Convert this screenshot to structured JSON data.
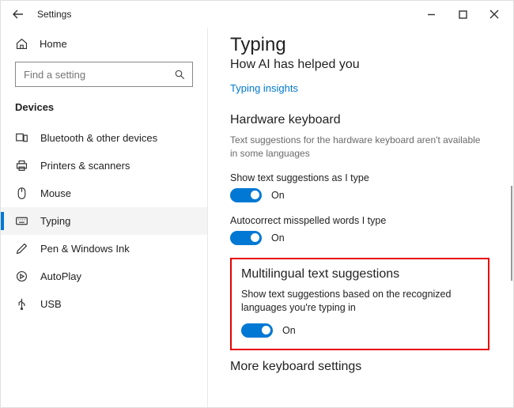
{
  "app": {
    "title": "Settings"
  },
  "sidebar": {
    "home_label": "Home",
    "search_placeholder": "Find a setting",
    "heading": "Devices",
    "items": [
      {
        "label": "Bluetooth & other devices"
      },
      {
        "label": "Printers & scanners"
      },
      {
        "label": "Mouse"
      },
      {
        "label": "Typing"
      },
      {
        "label": "Pen & Windows Ink"
      },
      {
        "label": "AutoPlay"
      },
      {
        "label": "USB"
      }
    ]
  },
  "main": {
    "title": "Typing",
    "subtitle": "How AI has helped you",
    "insights_link": "Typing insights",
    "hw_section": {
      "heading": "Hardware keyboard",
      "note": "Text suggestions for the hardware keyboard aren't available in some languages",
      "show_suggest_label": "Show text suggestions as I type",
      "show_suggest_state": "On",
      "autocorrect_label": "Autocorrect misspelled words I type",
      "autocorrect_state": "On"
    },
    "multi_section": {
      "heading": "Multilingual text suggestions",
      "desc": "Show text suggestions based on the recognized languages you're typing in",
      "state": "On"
    },
    "more_heading": "More keyboard settings"
  }
}
